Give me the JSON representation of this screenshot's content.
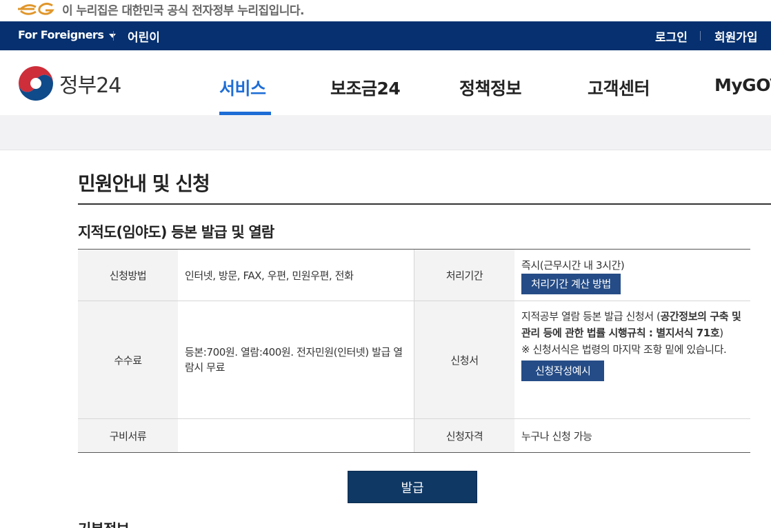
{
  "gov_banner": {
    "text": "이 누리집은 대한민국 공식 전자정부 누리집입니다.",
    "logo_icon": "eg-logo-icon"
  },
  "util_bar": {
    "foreigners": "For Foreigners",
    "kids": "어린이",
    "login": "로그인",
    "signup": "회원가입"
  },
  "header": {
    "logo_text": "정부24",
    "nav": [
      "서비스",
      "보조금24",
      "정책정보",
      "고객센터",
      "MyGOV"
    ],
    "active_index": 0,
    "accent": "#1e6dd6"
  },
  "main": {
    "page_title": "민원안내 및 신청",
    "sub_title": "지적도(임야도) 등본 발급 및 열람",
    "table": {
      "row1": {
        "h1": "신청방법",
        "v1": "인터넷, 방문, FAX, 우편, 민원우편, 전화",
        "h2": "처리기간",
        "v2": "즉시(근무시간 내 3시간)",
        "v2_button": "처리기간 계산 방법"
      },
      "row2": {
        "h1": "수수료",
        "v1": "등본:700원. 열람:400원. 전자민원(인터넷) 발급 열람시 무료",
        "h2": "신청서",
        "v2_text": "지적공부 열람 등본 발급 신청서 (",
        "v2_bold": "공간정보의 구축 및 관리 등에 관한 법률 시행규칙 : 별지서식 71호",
        "v2_close": ")",
        "v2_note": "※ 신청서식은 법령의 마지막 조항 밑에 있습니다.",
        "v2_button": "신청작성예시"
      },
      "row3": {
        "h1": "구비서류",
        "v1": "",
        "h2": "신청자격",
        "v2": "누구나 신청 가능"
      }
    },
    "issue_button": "발급",
    "next_section": "기본정보"
  }
}
